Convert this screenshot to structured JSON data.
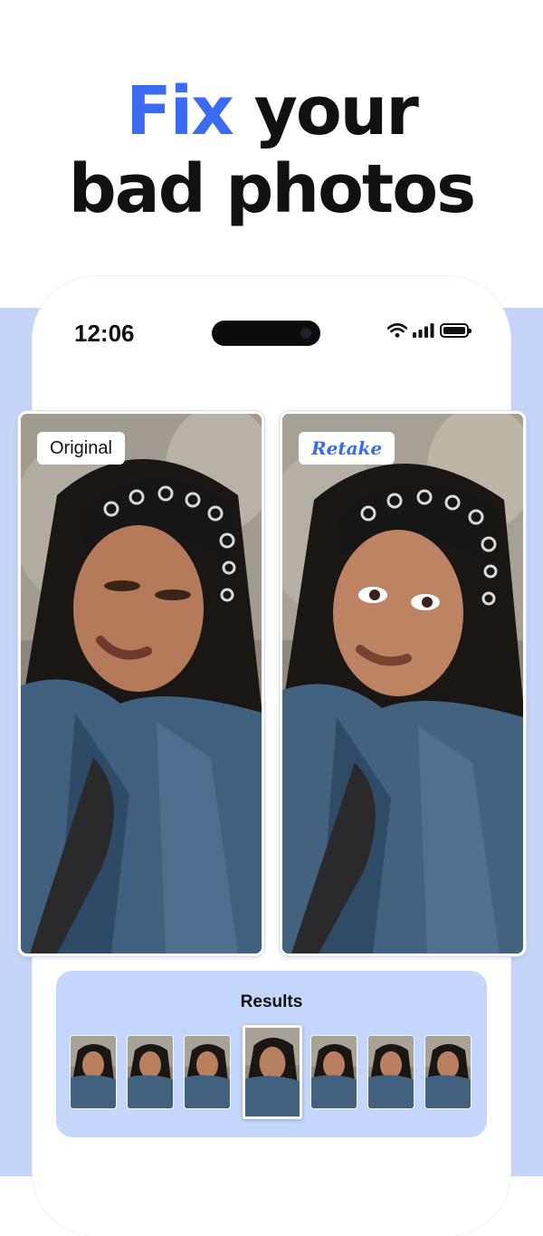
{
  "headline": {
    "accent_word": "Fix",
    "rest_line1": " your",
    "line2": "bad photos"
  },
  "status_bar": {
    "time": "12:06",
    "icons": [
      "wifi-icon",
      "cellular-signal-icon",
      "battery-icon"
    ]
  },
  "comparison": {
    "original_label": "Original",
    "retake_label": "Retake"
  },
  "results": {
    "title": "Results",
    "thumbnail_count": 7,
    "selected_index": 3
  },
  "colors": {
    "accent": "#3a6bf2",
    "panel_bg": "#c4d6fb",
    "side_bg": "#c4d4f8"
  }
}
